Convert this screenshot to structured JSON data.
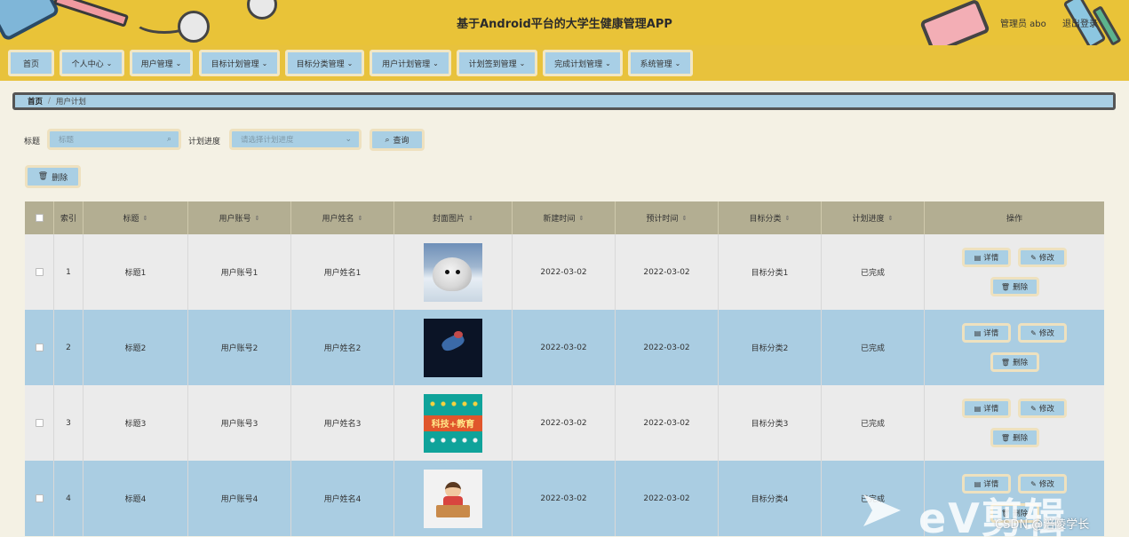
{
  "header": {
    "title": "基于Android平台的大学生健康管理APP",
    "user": "管理员 abo",
    "logout": "退出登录"
  },
  "nav": {
    "items": [
      {
        "label": "首页",
        "dropdown": false
      },
      {
        "label": "个人中心",
        "dropdown": true
      },
      {
        "label": "用户管理",
        "dropdown": true
      },
      {
        "label": "目标计划管理",
        "dropdown": true
      },
      {
        "label": "目标分类管理",
        "dropdown": true
      },
      {
        "label": "用户计划管理",
        "dropdown": true
      },
      {
        "label": "计划签到管理",
        "dropdown": true
      },
      {
        "label": "完成计划管理",
        "dropdown": true
      },
      {
        "label": "系统管理",
        "dropdown": true
      }
    ],
    "chevron": "⌄"
  },
  "breadcrumb": {
    "home": "首页",
    "sep": "/",
    "current": "用户计划"
  },
  "search": {
    "title_label": "标题",
    "title_placeholder": "标题",
    "progress_label": "计划进度",
    "progress_placeholder": "请选择计划进度",
    "query_button": "查询"
  },
  "toolbar": {
    "delete_button": "删除"
  },
  "table": {
    "columns": [
      "索引",
      "标题",
      "用户账号",
      "用户姓名",
      "封面图片",
      "新建时间",
      "预计时间",
      "目标分类",
      "计划进度",
      "操作"
    ],
    "sort_glyph": "⇕",
    "rows": [
      {
        "index": "1",
        "title": "标题1",
        "account": "用户账号1",
        "name": "用户姓名1",
        "created": "2022-03-02",
        "expected": "2022-03-02",
        "category": "目标分类1",
        "progress": "已完成"
      },
      {
        "index": "2",
        "title": "标题2",
        "account": "用户账号2",
        "name": "用户姓名2",
        "created": "2022-03-02",
        "expected": "2022-03-02",
        "category": "目标分类2",
        "progress": "已完成"
      },
      {
        "index": "3",
        "title": "标题3",
        "account": "用户账号3",
        "name": "用户姓名3",
        "created": "2022-03-02",
        "expected": "2022-03-02",
        "category": "目标分类3",
        "progress": "已完成"
      },
      {
        "index": "4",
        "title": "标题4",
        "account": "用户账号4",
        "name": "用户姓名4",
        "created": "2022-03-02",
        "expected": "2022-03-02",
        "category": "目标分类4",
        "progress": "已完成"
      }
    ],
    "ops": {
      "detail": "详情",
      "edit": "修改",
      "delete": "删除"
    },
    "thumb2_text": "科技+教育"
  },
  "watermark": {
    "ev": "eV剪辑",
    "csdn": "CSDN @涪陵学长"
  },
  "colors": {
    "header": "#e9c338",
    "accent": "#a9cfe4",
    "table_head": "#b3ae92"
  }
}
